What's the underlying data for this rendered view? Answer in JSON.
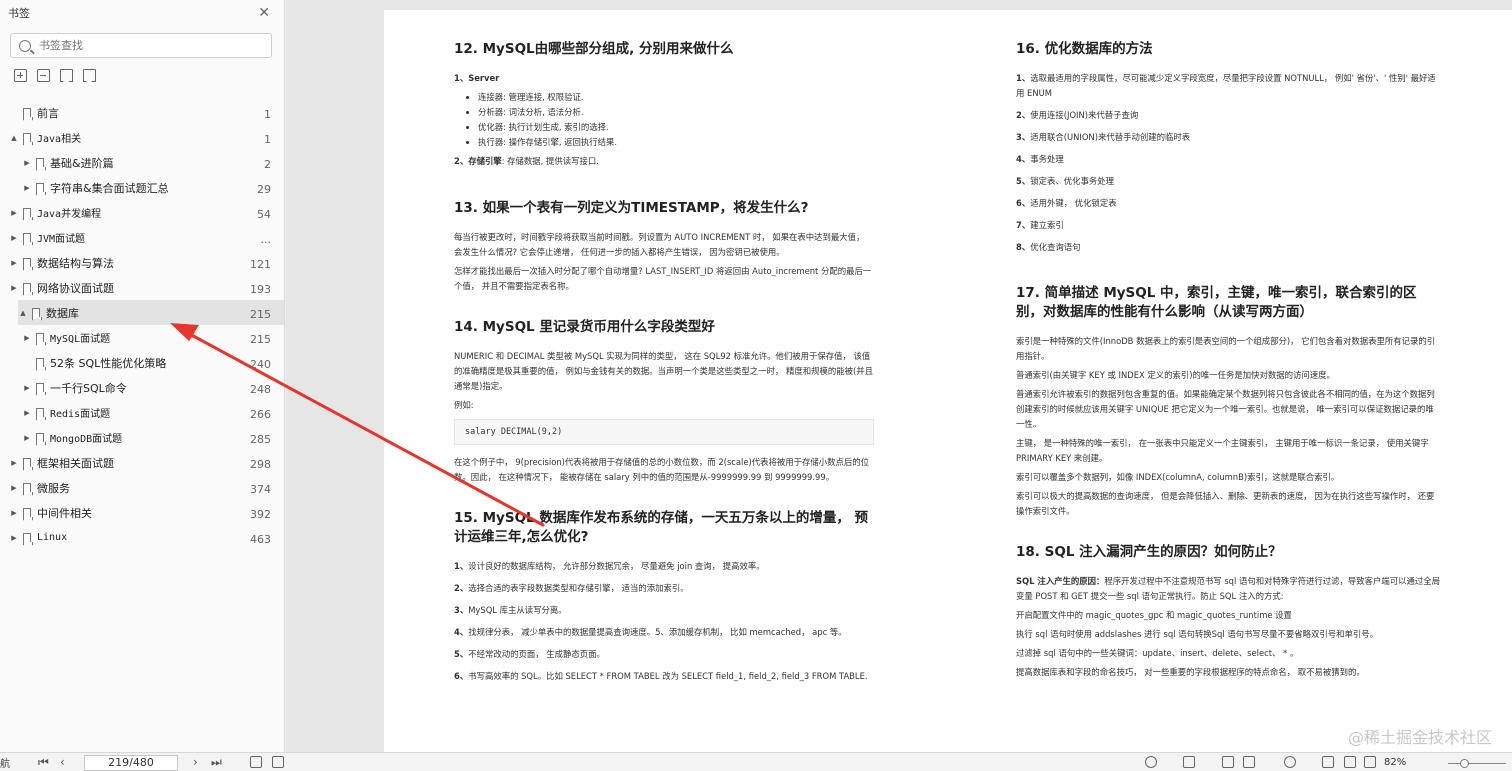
{
  "sidebar": {
    "title": "书签",
    "search_placeholder": "书签查找",
    "items": [
      {
        "label": "前言",
        "page": "1",
        "indent": 0,
        "arrow": "",
        "mono": false
      },
      {
        "label": "Java相关",
        "page": "1",
        "indent": 0,
        "arrow": "▲",
        "mono": true
      },
      {
        "label": "基础&进阶篇",
        "page": "2",
        "indent": 1,
        "arrow": "▶",
        "mono": false
      },
      {
        "label": "字符串&集合面试题汇总",
        "page": "29",
        "indent": 1,
        "arrow": "▶",
        "mono": false
      },
      {
        "label": "Java并发编程",
        "page": "54",
        "indent": 0,
        "arrow": "▶",
        "mono": true
      },
      {
        "label": "JVM面试题",
        "page": "...",
        "indent": 0,
        "arrow": "▶",
        "mono": true
      },
      {
        "label": "数据结构与算法",
        "page": "121",
        "indent": 0,
        "arrow": "▶",
        "mono": false
      },
      {
        "label": "网络协议面试题",
        "page": "193",
        "indent": 0,
        "arrow": "▶",
        "mono": false
      },
      {
        "label": "数据库",
        "page": "215",
        "indent": 0,
        "arrow": "▲",
        "mono": false,
        "selected": true
      },
      {
        "label": "MySQL面试题",
        "page": "215",
        "indent": 1,
        "arrow": "▶",
        "mono": true
      },
      {
        "label": "52条 SQL性能优化策略",
        "page": "240",
        "indent": 1,
        "arrow": "",
        "mono": false
      },
      {
        "label": "一千行SQL命令",
        "page": "248",
        "indent": 1,
        "arrow": "▶",
        "mono": false
      },
      {
        "label": "Redis面试题",
        "page": "266",
        "indent": 1,
        "arrow": "▶",
        "mono": true
      },
      {
        "label": "MongoDB面试题",
        "page": "285",
        "indent": 1,
        "arrow": "▶",
        "mono": true
      },
      {
        "label": "框架相关面试题",
        "page": "298",
        "indent": 0,
        "arrow": "▶",
        "mono": false
      },
      {
        "label": "微服务",
        "page": "374",
        "indent": 0,
        "arrow": "▶",
        "mono": false
      },
      {
        "label": "中间件相关",
        "page": "392",
        "indent": 0,
        "arrow": "▶",
        "mono": false
      },
      {
        "label": "Linux",
        "page": "463",
        "indent": 0,
        "arrow": "▶",
        "mono": true
      }
    ]
  },
  "doc": {
    "q12": {
      "title": "12. MySQL由哪些部分组成, 分别用来做什么",
      "p1_num": "1、",
      "p1": "Server",
      "bullets": [
        "连接器: 管理连接, 权限验证.",
        "分析器: 词法分析, 语法分析.",
        "优化器: 执行计划生成, 索引的选择.",
        "执行器: 操作存储引擎, 返回执行结果."
      ],
      "p2_num": "2、",
      "p2_bold": "存储引擎",
      "p2": ": 存储数据, 提供读写接口."
    },
    "q13": {
      "title": "13. 如果一个表有一列定义为TIMESTAMP，将发生什么?",
      "p1": "每当行被更改时，时间戳字段将获取当前时间戳。列设置为 AUTO INCREMENT 时， 如果在表中达到最大值， 会发生什么情况? 它会停止递增， 任何进一步的插入都将产生错误， 因为密钥已被使用。",
      "p2": "怎样才能找出最后一次插入时分配了哪个自动增量? LAST_INSERT_ID 将返回由 Auto_increment 分配的最后一个值， 并且不需要指定表名称。"
    },
    "q14": {
      "title": "14. MySQL 里记录货币用什么字段类型好",
      "p1": "NUMERIC 和 DECIMAL 类型被 MySQL 实现为同样的类型， 这在 SQL92 标准允许。他们被用于保存值， 该值的准确精度是极其重要的值， 例如与金钱有关的数据。当声明一个类是这些类型之一时， 精度和规模的能被(并且通常是)指定。",
      "p2": "例如:",
      "code": "salary DECIMAL(9,2)",
      "p3": "在这个例子中， 9(precision)代表将被用于存储值的总的小数位数，而 2(scale)代表将被用于存储小数点后的位数。因此， 在这种情况下， 能被存储在 salary 列中的值的范围是从-9999999.99 到 9999999.99。"
    },
    "q15": {
      "title": "15. MySQL 数据库作发布系统的存储，一天五万条以上的增量， 预计运维三年,怎么优化?",
      "items": [
        {
          "num": "1、",
          "text": "设计良好的数据库结构， 允许部分数据冗余， 尽量避免 join 查询， 提高效率。"
        },
        {
          "num": "2、",
          "text": "选择合适的表字段数据类型和存储引擎， 适当的添加索引。"
        },
        {
          "num": "3、",
          "text": "MySQL 库主从读写分离。"
        },
        {
          "num": "4、",
          "text": "找规律分表， 减少单表中的数据量提高查询速度。5、添加缓存机制， 比如 memcached， apc 等。"
        },
        {
          "num": "5、",
          "text": "不经常改动的页面， 生成静态页面。"
        },
        {
          "num": "6、",
          "text": "书写高效率的 SQL。比如 SELECT * FROM TABEL 改为 SELECT field_1, field_2, field_3 FROM TABLE."
        }
      ]
    },
    "q16": {
      "title": "16. 优化数据库的方法",
      "items": [
        {
          "num": "1、",
          "text": "选取最适用的字段属性，尽可能减少定义字段宽度，尽量把字段设置 NOTNULL， 例如' 省份'、' 性别' 最好适用 ENUM"
        },
        {
          "num": "2、",
          "text": "使用连接(JOIN)来代替子查询"
        },
        {
          "num": "3、",
          "text": "适用联合(UNION)来代替手动创建的临时表"
        },
        {
          "num": "4、",
          "text": "事务处理"
        },
        {
          "num": "5、",
          "text": "锁定表、优化事务处理"
        },
        {
          "num": "6、",
          "text": "适用外键， 优化锁定表"
        },
        {
          "num": "7、",
          "text": "建立索引"
        },
        {
          "num": "8、",
          "text": "优化查询语句"
        }
      ]
    },
    "q17": {
      "title": "17. 简单描述 MySQL 中，索引，主键，唯一索引，联合索引的区别，对数据库的性能有什么影响（从读写两方面）",
      "paras": [
        "索引是一种特殊的文件(InnoDB 数据表上的索引是表空间的一个组成部分)， 它们包含着对数据表里所有记录的引用指针。",
        "普通索引(由关键字 KEY 或 INDEX 定义的索引)的唯一任务是加快对数据的访问速度。",
        "普通索引允许被索引的数据列包含重复的值。如果能确定某个数据列将只包含彼此各不相同的值，在为这个数据列创建索引的时候就应该用关键字 UNIQUE 把它定义为一个唯一索引。也就是说， 唯一索引可以保证数据记录的唯一性。",
        "主键， 是一种特殊的唯一索引， 在一张表中只能定义一个主键索引， 主键用于唯一标识一条记录， 使用关键字 PRIMARY KEY 来创建。",
        "索引可以覆盖多个数据列，如像 INDEX(columnA, columnB)索引，这就是联合索引。",
        "索引可以极大的提高数据的查询速度， 但是会降低插入、删除、更新表的速度， 因为在执行这些写操作时， 还要操作索引文件。"
      ]
    },
    "q18": {
      "title": "18. SQL 注入漏洞产生的原因？如何防止？",
      "p1_bold": "SQL 注入产生的原因：",
      "p1": "程序开发过程中不注意规范书写 sql 语句和对特殊字符进行过滤，导致客户端可以通过全局变量 POST 和 GET 提交一些 sql 语句正常执行。防止 SQL 注入的方式:",
      "paras": [
        "开启配置文件中的 magic_quotes_gpc 和 magic_quotes_runtime 设置",
        "执行 sql 语句时使用 addslashes 进行 sql 语句转换Sql 语句书写尽量不要省略双引号和单引号。",
        "过滤掉 sql 语句中的一些关键词：update、insert、delete、select、 * 。",
        "提高数据库表和字段的命名技巧， 对一些重要的字段根据程序的特点命名， 取不易被猜到的。"
      ]
    },
    "watermark": "@稀土掘金技术社区"
  },
  "bottombar": {
    "nav_label": "航",
    "page_indicator": "219/480",
    "zoom": "82%"
  },
  "colors": {
    "annotation": "#e8352b",
    "selected_row": "#e3e3e3"
  }
}
